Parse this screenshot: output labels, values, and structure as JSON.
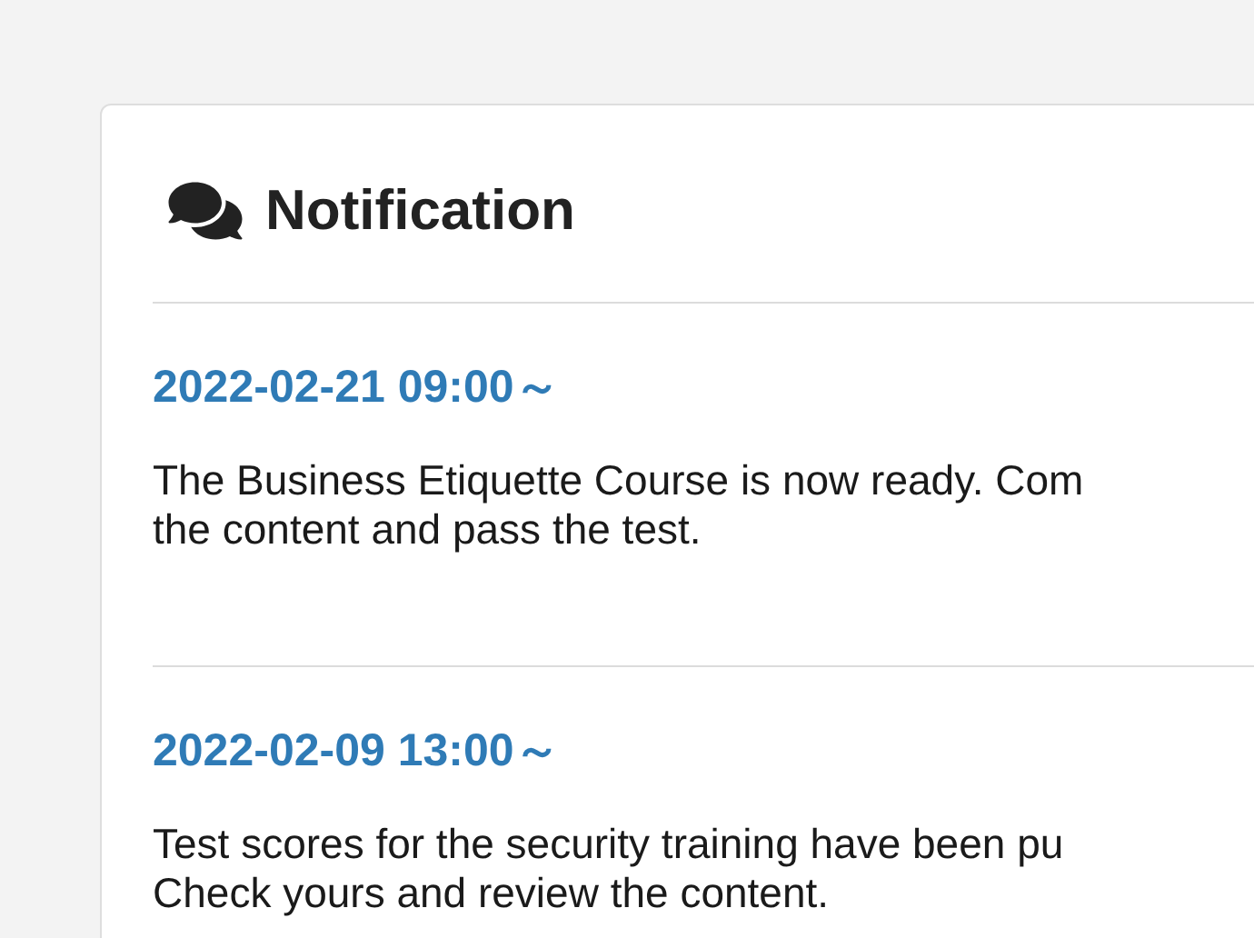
{
  "panel": {
    "title": "Notification"
  },
  "notifications": [
    {
      "date": "2022-02-21 09:00～",
      "lines": [
        "The Business Etiquette Course is now ready. Com",
        "the content and pass the test."
      ]
    },
    {
      "date": "2022-02-09 13:00～",
      "lines": [
        "Test scores for the security training have been pu",
        "Check yours and review the content."
      ]
    }
  ]
}
